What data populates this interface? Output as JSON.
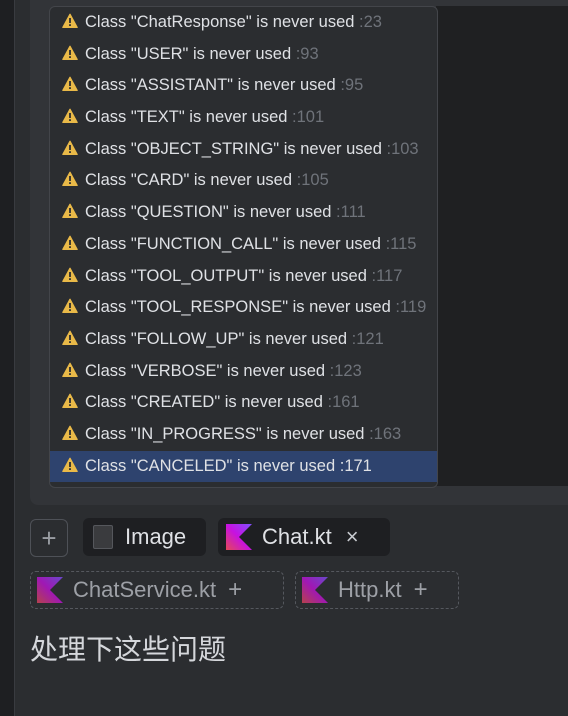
{
  "problems": [
    {
      "text": "Class \"ChatResponse\" is never used",
      "loc": ":23",
      "selected": false
    },
    {
      "text": "Class \"USER\" is never used",
      "loc": ":93",
      "selected": false
    },
    {
      "text": "Class \"ASSISTANT\" is never used",
      "loc": ":95",
      "selected": false
    },
    {
      "text": "Class \"TEXT\" is never used",
      "loc": ":101",
      "selected": false
    },
    {
      "text": "Class \"OBJECT_STRING\" is never used",
      "loc": ":103",
      "selected": false
    },
    {
      "text": "Class \"CARD\" is never used",
      "loc": ":105",
      "selected": false
    },
    {
      "text": "Class \"QUESTION\" is never used",
      "loc": ":111",
      "selected": false
    },
    {
      "text": "Class \"FUNCTION_CALL\" is never used",
      "loc": ":115",
      "selected": false
    },
    {
      "text": "Class \"TOOL_OUTPUT\" is never used",
      "loc": ":117",
      "selected": false
    },
    {
      "text": "Class \"TOOL_RESPONSE\" is never used",
      "loc": ":119",
      "selected": false
    },
    {
      "text": "Class \"FOLLOW_UP\" is never used",
      "loc": ":121",
      "selected": false
    },
    {
      "text": "Class \"VERBOSE\" is never used",
      "loc": ":123",
      "selected": false
    },
    {
      "text": "Class \"CREATED\" is never used",
      "loc": ":161",
      "selected": false
    },
    {
      "text": "Class \"IN_PROGRESS\" is never used",
      "loc": ":163",
      "selected": false
    },
    {
      "text": "Class \"CANCELED\" is never used",
      "loc": ":171",
      "selected": true
    }
  ],
  "context": {
    "add_label": "+",
    "image_label": "Image",
    "chat_file": "Chat.kt",
    "close_label": "×",
    "suggested": [
      {
        "file": "ChatService.kt",
        "add": "+"
      },
      {
        "file": "Http.kt",
        "add": "+"
      }
    ]
  },
  "prompt_text": "处理下这些问题",
  "colors": {
    "warning": "#e9b948",
    "selection": "#2e436e",
    "kotlin_start": "#e44857",
    "kotlin_mid": "#c711e1",
    "kotlin_end": "#7f52ff"
  }
}
